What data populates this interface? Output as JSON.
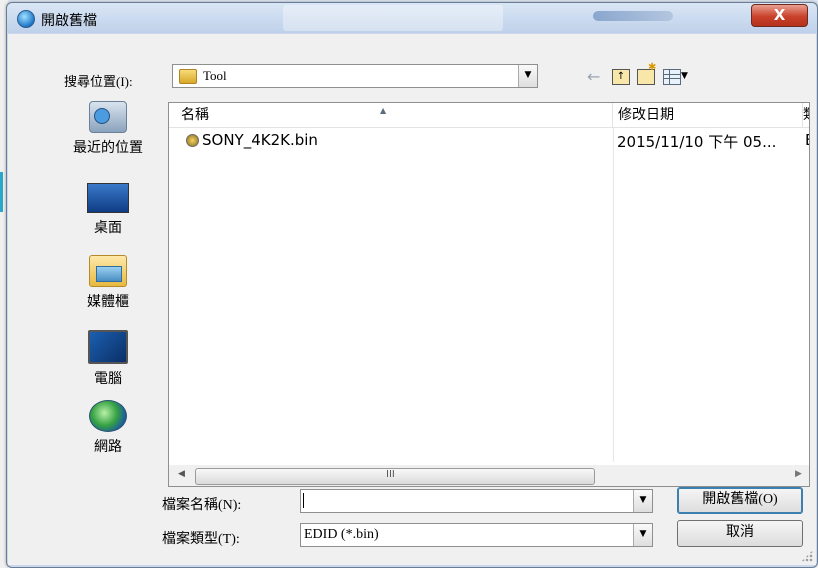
{
  "window": {
    "title": "開啟舊檔",
    "close_label": "X"
  },
  "toolbar": {
    "look_in_label": "搜尋位置(I):",
    "look_in_value": "Tool",
    "back_icon": "back-arrow-icon",
    "up_icon": "up-folder-icon",
    "new_folder_icon": "new-folder-icon",
    "view_menu_icon": "view-menu-icon"
  },
  "places": [
    {
      "label": "最近的位置",
      "icon": "recent-places-icon"
    },
    {
      "label": "桌面",
      "icon": "desktop-icon"
    },
    {
      "label": "媒體櫃",
      "icon": "libraries-icon"
    },
    {
      "label": "電腦",
      "icon": "computer-icon"
    },
    {
      "label": "網路",
      "icon": "network-icon"
    }
  ],
  "file_list": {
    "columns": [
      "名稱",
      "修改日期",
      "類"
    ],
    "rows": [
      {
        "name": "SONY_4K2K.bin",
        "date": "2015/11/10 下午 05...",
        "type": "E"
      }
    ],
    "scroll_grip": "III"
  },
  "form": {
    "filename_label": "檔案名稱(N):",
    "filename_value": "",
    "filetype_label": "檔案類型(T):",
    "filetype_value": "EDID (*.bin)",
    "open_button": "開啟舊檔(O)",
    "cancel_button": "取消"
  },
  "colors": {
    "title_bar": "#c9d8ec",
    "close_button": "#c9412a",
    "client": "#f0f0f0"
  }
}
